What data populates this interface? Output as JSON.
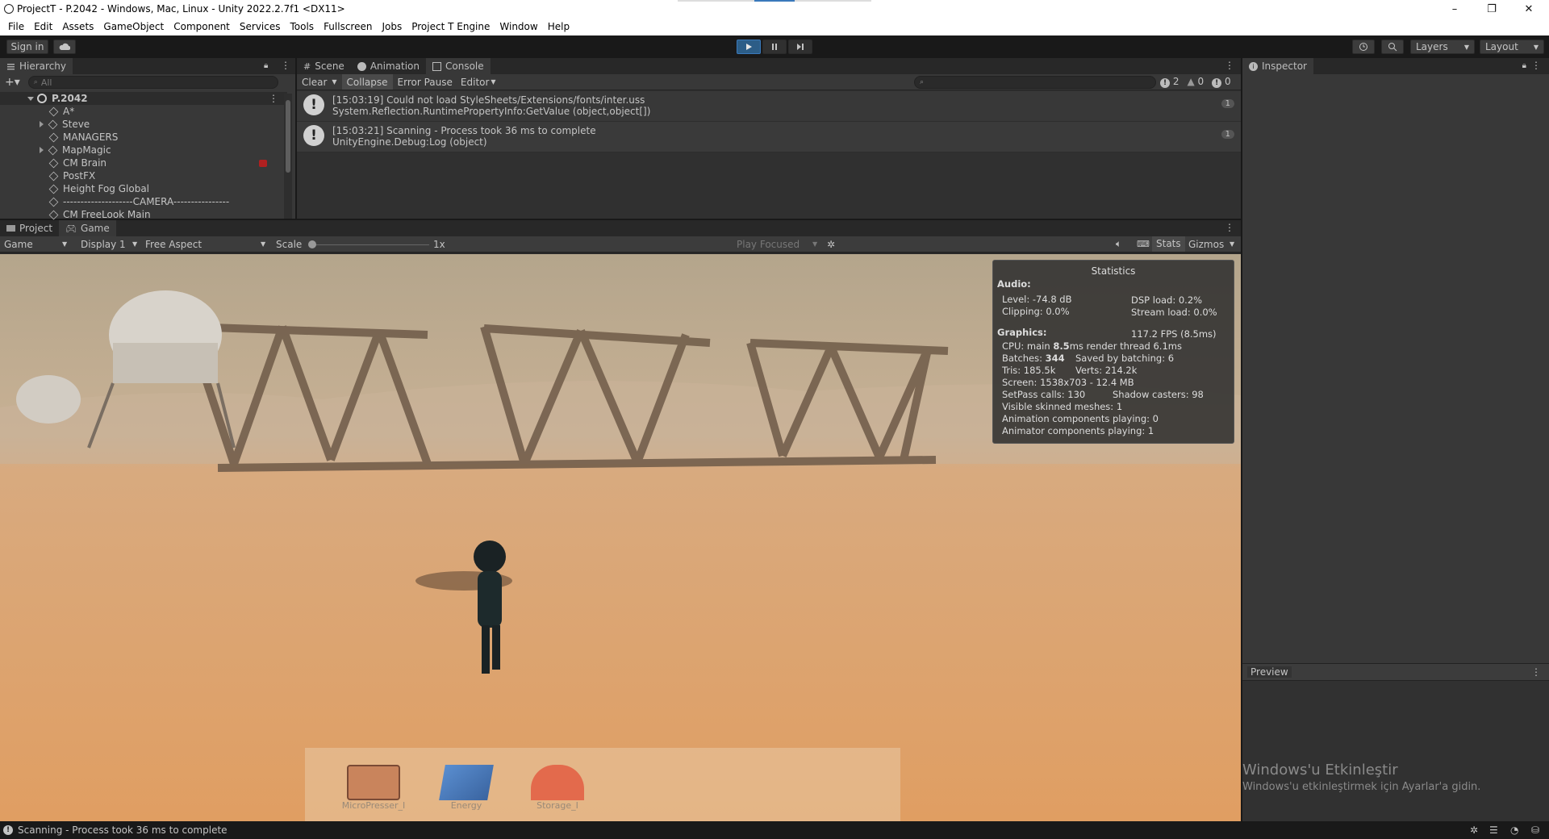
{
  "window": {
    "title": "ProjectT - P.2042 - Windows, Mac, Linux - Unity 2022.2.7f1 <DX11>",
    "minimize": "–",
    "restore": "❐",
    "close": "✕"
  },
  "menu": [
    "File",
    "Edit",
    "Assets",
    "GameObject",
    "Component",
    "Services",
    "Tools",
    "Fullscreen",
    "Jobs",
    "Project T Engine",
    "Window",
    "Help"
  ],
  "toolbar": {
    "sign_in": "Sign in",
    "layers": "Layers",
    "layout": "Layout"
  },
  "hierarchy": {
    "tab": "Hierarchy",
    "search_placeholder": "All",
    "scene": "P.2042",
    "items": [
      "A*",
      "Steve",
      "MANAGERS",
      "MapMagic",
      "CM Brain",
      "PostFX",
      "Height Fog Global",
      "--------------------CAMERA----------------",
      "CM FreeLook Main"
    ]
  },
  "center_tabs": {
    "scene": "Scene",
    "animation": "Animation",
    "console": "Console"
  },
  "console": {
    "clear": "Clear",
    "collapse": "Collapse",
    "error_pause": "Error Pause",
    "editor": "Editor",
    "count_info": "2",
    "count_warn": "0",
    "count_error": "0",
    "entries": [
      {
        "line1": "[15:03:19] Could not load StyleSheets/Extensions/fonts/inter.uss",
        "line2": "System.Reflection.RuntimePropertyInfo:GetValue (object,object[])",
        "count": "1"
      },
      {
        "line1": "[15:03:21] Scanning - Process took 36 ms to complete",
        "line2": "UnityEngine.Debug:Log (object)",
        "count": "1"
      }
    ]
  },
  "inspector": {
    "tab": "Inspector",
    "preview": "Preview"
  },
  "bottom_tabs": {
    "project": "Project",
    "game": "Game"
  },
  "game_bar": {
    "game": "Game",
    "display": "Display 1",
    "aspect": "Free Aspect",
    "scale_label": "Scale",
    "scale_value": "1x",
    "scale_level": 0.0,
    "play_focused": "Play Focused",
    "stats": "Stats",
    "gizmos": "Gizmos"
  },
  "statistics": {
    "title": "Statistics",
    "audio": "Audio:",
    "level": "Level: -74.8 dB",
    "clipping": "Clipping: 0.0%",
    "dsp": "DSP load: 0.2%",
    "stream": "Stream load: 0.0%",
    "graphics": "Graphics:",
    "fps": "117.2 FPS (8.5ms)",
    "cpu_prefix": "CPU: main ",
    "cpu_main": "8.5",
    "cpu_suffix": "ms  render thread 6.1ms",
    "batches_prefix": "Batches: ",
    "batches": "344",
    "saved": "Saved by batching: 6",
    "tris": "Tris: 185.5k",
    "verts": "Verts: 214.2k",
    "screen": "Screen: 1538x703 - 12.4 MB",
    "setpass": "SetPass calls: 130",
    "shadow": "Shadow casters: 98",
    "skinned": "Visible skinned meshes: 1",
    "anim": "Animation components playing: 0",
    "animator": "Animator components playing: 1"
  },
  "game_hud": [
    "MicroPresser_I",
    "Energy",
    "Storage_I"
  ],
  "watermark": {
    "line1": "Windows'u Etkinleştir",
    "line2": "Windows'u etkinleştirmek için Ayarlar'a gidin."
  },
  "status": "Scanning - Process took 36 ms to complete",
  "colors": {
    "accent": "#3a79bb",
    "play_active": "#2c5d87",
    "editor_bg": "#383838",
    "sand": "#d89f6c"
  }
}
